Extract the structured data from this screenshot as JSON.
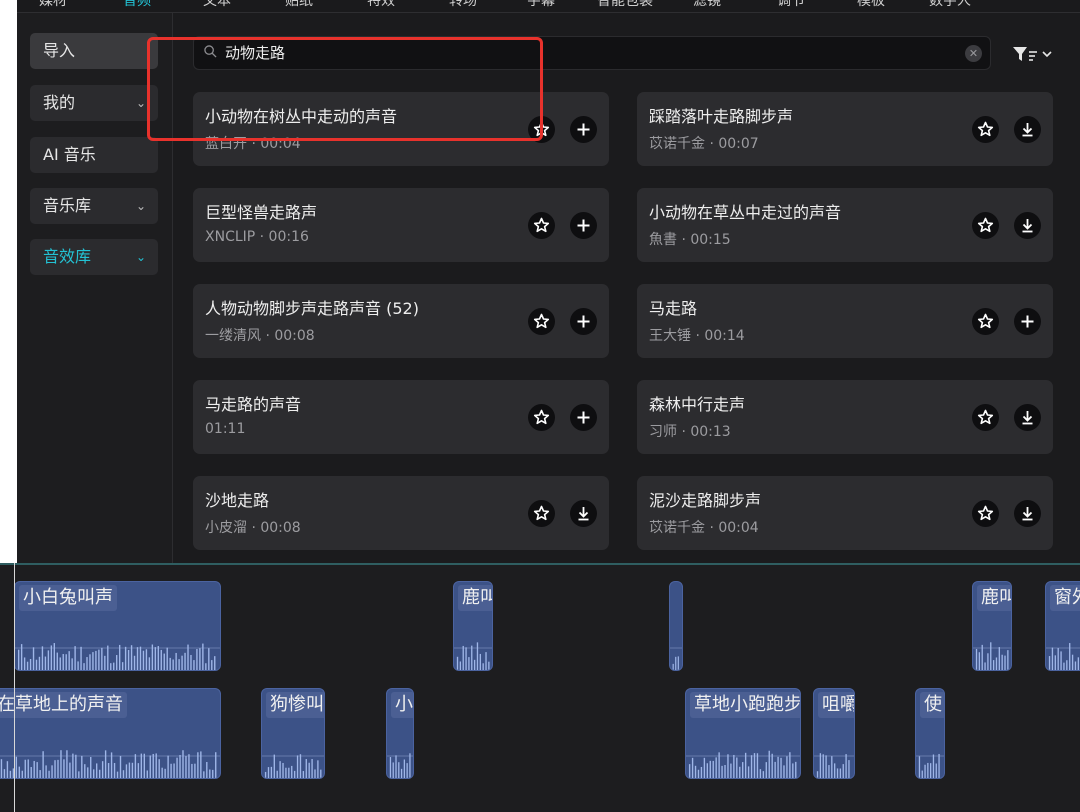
{
  "topnav": {
    "tabs": [
      {
        "label": "媒材",
        "active": false
      },
      {
        "label": "音频",
        "active": true
      },
      {
        "label": "文本",
        "active": false
      },
      {
        "label": "贴纸",
        "active": false
      },
      {
        "label": "特效",
        "active": false
      },
      {
        "label": "转场",
        "active": false
      },
      {
        "label": "字幕",
        "active": false
      },
      {
        "label": "智能包装",
        "active": false
      },
      {
        "label": "滤镜",
        "active": false
      },
      {
        "label": "调节",
        "active": false
      },
      {
        "label": "模板",
        "active": false
      },
      {
        "label": "数字人",
        "active": false
      }
    ]
  },
  "sidebar": {
    "items": [
      {
        "label": "导入",
        "has_chevron": false,
        "active": false
      },
      {
        "label": "我的",
        "has_chevron": true,
        "active": false
      },
      {
        "label": "AI 音乐",
        "has_chevron": false,
        "active": false
      },
      {
        "label": "音乐库",
        "has_chevron": true,
        "active": false
      },
      {
        "label": "音效库",
        "has_chevron": true,
        "active": true
      }
    ]
  },
  "search": {
    "query": "动物走路",
    "clear_icon": "close-icon",
    "filter_icon": "filter-icon"
  },
  "results": [
    {
      "title": "小动物在树丛中走动的声音",
      "meta": "蓝白开 · 00:04",
      "action": "add"
    },
    {
      "title": "踩踏落叶走路脚步声",
      "meta": "苡诺千金 · 00:07",
      "action": "download"
    },
    {
      "title": "巨型怪兽走路声",
      "meta": "XNCLIP · 00:16",
      "action": "add"
    },
    {
      "title": "小动物在草丛中走过的声音",
      "meta": "魚書 · 00:15",
      "action": "download"
    },
    {
      "title": "人物动物脚步声走路声音 (52)",
      "meta": "一缕清风 · 00:08",
      "action": "add"
    },
    {
      "title": "马走路",
      "meta": "王大锤 · 00:14",
      "action": "add"
    },
    {
      "title": "马走路的声音",
      "meta": "01:11",
      "action": "add"
    },
    {
      "title": "森林中行走声",
      "meta": "习师 · 00:13",
      "action": "download"
    },
    {
      "title": "沙地走路",
      "meta": "小皮溜 · 00:08",
      "action": "download"
    },
    {
      "title": "泥沙走路脚步声",
      "meta": "苡诺千金 · 00:04",
      "action": "download"
    }
  ],
  "timeline": {
    "track1": [
      {
        "label": "小白兔叫声"
      },
      {
        "label": "鹿叫"
      },
      {
        "label": ""
      },
      {
        "label": "鹿叫"
      },
      {
        "label": "窗外"
      }
    ],
    "track2": [
      {
        "label": "走在草地上的声音"
      },
      {
        "label": "狗惨叫"
      },
      {
        "label": "小"
      },
      {
        "label": "草地小跑跑步"
      },
      {
        "label": "咀嚼"
      },
      {
        "label": "使"
      }
    ]
  },
  "colors": {
    "accent": "#23c2d4",
    "highlight": "#e8322c",
    "clip": "#3c5287"
  }
}
